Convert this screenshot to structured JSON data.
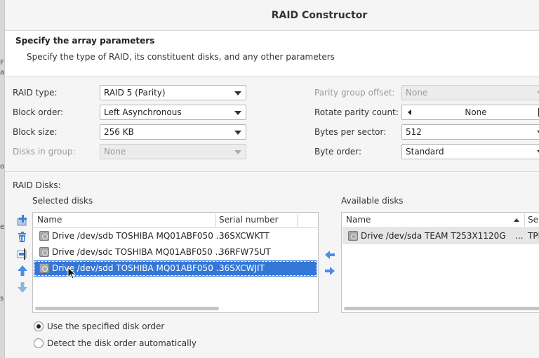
{
  "window": {
    "title": "RAID Constructor"
  },
  "header": {
    "heading": "Specify the array parameters",
    "description": "Specify the type of RAID, its constituent disks, and any other parameters"
  },
  "params_left": [
    {
      "label": "RAID type:",
      "value": "RAID 5 (Parity)",
      "enabled": true
    },
    {
      "label": "Block order:",
      "value": "Left Asynchronous",
      "enabled": true
    },
    {
      "label": "Block size:",
      "value": "256 KB",
      "enabled": true
    },
    {
      "label": "Disks in group:",
      "value": "None",
      "enabled": false
    }
  ],
  "params_right": {
    "parity_group_offset": {
      "label": "Parity group offset:",
      "value": "None",
      "enabled": false
    },
    "rotate_parity_count": {
      "label": "Rotate parity count:",
      "value": "None"
    },
    "bytes_per_sector": {
      "label": "Bytes per sector:",
      "value": "512"
    },
    "byte_order": {
      "label": "Byte order:",
      "value": "Standard"
    }
  },
  "raid_disks": {
    "section_label": "RAID Disks:",
    "selected_label": "Selected disks",
    "available_label": "Available disks",
    "selected_columns": [
      "Name",
      "Serial number"
    ],
    "available_columns": [
      "Name",
      "Ser"
    ],
    "selected_rows": [
      {
        "name": "Drive /dev/sdb TOSHIBA MQ01ABF050 ...",
        "serial": "36SXCWKTT",
        "selected": false
      },
      {
        "name": "Drive /dev/sdc TOSHIBA MQ01ABF050 ...",
        "serial": "36RFW75UT",
        "selected": false
      },
      {
        "name": "Drive /dev/sdd TOSHIBA MQ01ABF050 ...",
        "serial": "36SXCWJIT",
        "selected": true
      }
    ],
    "available_rows": [
      {
        "name": "Drive /dev/sda TEAM T253X1120G",
        "more": "...",
        "serial": "TPE"
      }
    ],
    "toolbar_icons": [
      "add-icon",
      "delete-icon",
      "edit-icon",
      "move-up-icon",
      "move-down-icon"
    ],
    "transfer_icons": [
      "move-left-icon",
      "move-right-icon"
    ]
  },
  "disk_order": {
    "options": [
      {
        "label": "Use the specified disk order",
        "checked": true
      },
      {
        "label": "Detect the disk order automatically",
        "checked": false
      }
    ]
  },
  "colors": {
    "selection": "#3477d8",
    "icon_blue": "#4a8ee6"
  }
}
